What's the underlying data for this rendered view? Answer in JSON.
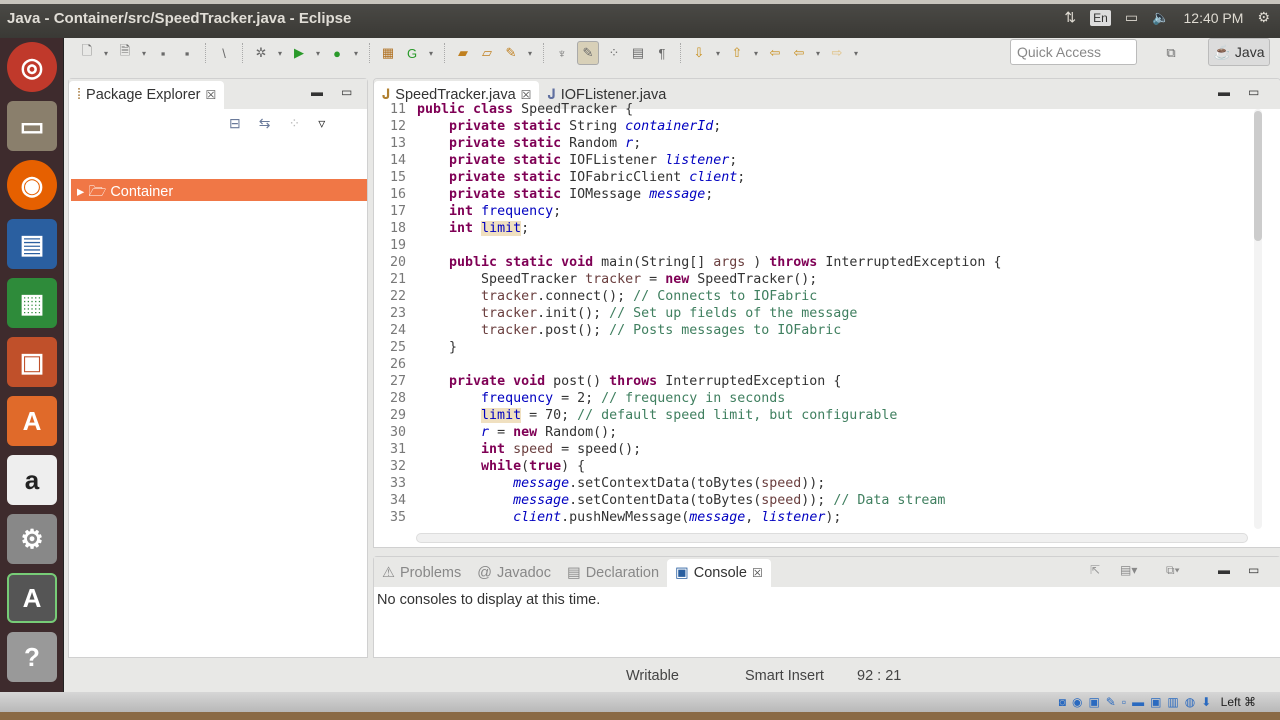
{
  "window": {
    "title": "Java - Container/src/SpeedTracker.java - Eclipse",
    "clock": "12:40 PM",
    "lang": "En"
  },
  "launcher": [
    "ubuntu-dash",
    "files",
    "firefox",
    "writer",
    "calc",
    "impress",
    "software-center",
    "amazon",
    "system-settings",
    "software-updater",
    "help"
  ],
  "toolbar": {
    "quick_access": "Quick Access",
    "perspective": "Java"
  },
  "package_explorer": {
    "title": "Package Explorer",
    "items": [
      "Container"
    ]
  },
  "editor": {
    "tabs": [
      "SpeedTracker.java",
      "IOFListener.java"
    ],
    "lines": [
      {
        "n": "11",
        "t": [
          [
            "kw",
            "public class "
          ],
          [
            "",
            "SpeedTracker {"
          ]
        ]
      },
      {
        "n": "12",
        "t": [
          [
            "",
            "    "
          ],
          [
            "kw",
            "private static "
          ],
          [
            "",
            "String "
          ],
          [
            "sfld",
            "containerId"
          ],
          [
            "",
            ";"
          ]
        ]
      },
      {
        "n": "13",
        "t": [
          [
            "",
            "    "
          ],
          [
            "kw",
            "private static "
          ],
          [
            "",
            "Random "
          ],
          [
            "sfld",
            "r"
          ],
          [
            "",
            ";"
          ]
        ]
      },
      {
        "n": "14",
        "t": [
          [
            "",
            "    "
          ],
          [
            "kw",
            "private static "
          ],
          [
            "",
            "IOFListener "
          ],
          [
            "sfld",
            "listener"
          ],
          [
            "",
            ";"
          ]
        ]
      },
      {
        "n": "15",
        "t": [
          [
            "",
            "    "
          ],
          [
            "kw",
            "private static "
          ],
          [
            "",
            "IOFabricClient "
          ],
          [
            "sfld",
            "client"
          ],
          [
            "",
            ";"
          ]
        ]
      },
      {
        "n": "16",
        "t": [
          [
            "",
            "    "
          ],
          [
            "kw",
            "private static "
          ],
          [
            "",
            "IOMessage "
          ],
          [
            "sfld",
            "message"
          ],
          [
            "",
            ";"
          ]
        ]
      },
      {
        "n": "17",
        "t": [
          [
            "",
            "    "
          ],
          [
            "kw",
            "int "
          ],
          [
            "fld",
            "frequency"
          ],
          [
            "",
            ";"
          ]
        ]
      },
      {
        "n": "18",
        "t": [
          [
            "",
            "    "
          ],
          [
            "kw",
            "int "
          ],
          [
            "fld hl",
            "limit"
          ],
          [
            "",
            ";"
          ]
        ]
      },
      {
        "n": "19",
        "t": []
      },
      {
        "n": "20",
        "t": [
          [
            "",
            "    "
          ],
          [
            "kw",
            "public static void "
          ],
          [
            "",
            "main(String[] "
          ],
          [
            "lv",
            "args"
          ],
          [
            "",
            " ) "
          ],
          [
            "kw",
            "throws "
          ],
          [
            "",
            "InterruptedException {"
          ]
        ]
      },
      {
        "n": "21",
        "t": [
          [
            "",
            "        SpeedTracker "
          ],
          [
            "lv",
            "tracker"
          ],
          [
            "",
            " = "
          ],
          [
            "kw",
            "new "
          ],
          [
            "",
            "SpeedTracker();"
          ]
        ]
      },
      {
        "n": "22",
        "t": [
          [
            "",
            "        "
          ],
          [
            "lv",
            "tracker"
          ],
          [
            "",
            ".connect(); "
          ],
          [
            "cm",
            "// Connects to IOFabric"
          ]
        ]
      },
      {
        "n": "23",
        "t": [
          [
            "",
            "        "
          ],
          [
            "lv",
            "tracker"
          ],
          [
            "",
            ".init(); "
          ],
          [
            "cm",
            "// Set up fields of the message"
          ]
        ]
      },
      {
        "n": "24",
        "t": [
          [
            "",
            "        "
          ],
          [
            "lv",
            "tracker"
          ],
          [
            "",
            ".post(); "
          ],
          [
            "cm",
            "// Posts messages to IOFabric"
          ]
        ]
      },
      {
        "n": "25",
        "t": [
          [
            "",
            "    }"
          ]
        ]
      },
      {
        "n": "26",
        "t": []
      },
      {
        "n": "27",
        "t": [
          [
            "",
            "    "
          ],
          [
            "kw",
            "private void "
          ],
          [
            "",
            "post() "
          ],
          [
            "kw",
            "throws "
          ],
          [
            "",
            "InterruptedException {"
          ]
        ]
      },
      {
        "n": "28",
        "t": [
          [
            "",
            "        "
          ],
          [
            "fld",
            "frequency"
          ],
          [
            "",
            " = 2; "
          ],
          [
            "cm",
            "// frequency in seconds"
          ]
        ]
      },
      {
        "n": "29",
        "t": [
          [
            "",
            "        "
          ],
          [
            "fld hl",
            "limit"
          ],
          [
            "",
            " = 70; "
          ],
          [
            "cm",
            "// default speed limit, but configurable"
          ]
        ]
      },
      {
        "n": "30",
        "t": [
          [
            "",
            "        "
          ],
          [
            "sfld",
            "r"
          ],
          [
            "",
            " = "
          ],
          [
            "kw",
            "new "
          ],
          [
            "",
            "Random();"
          ]
        ]
      },
      {
        "n": "31",
        "t": [
          [
            "",
            "        "
          ],
          [
            "kw",
            "int "
          ],
          [
            "lv",
            "speed"
          ],
          [
            "",
            " = speed();"
          ]
        ]
      },
      {
        "n": "32",
        "t": [
          [
            "",
            "        "
          ],
          [
            "kw",
            "while"
          ],
          [
            "",
            "("
          ],
          [
            "kw",
            "true"
          ],
          [
            "",
            ") {"
          ]
        ]
      },
      {
        "n": "33",
        "t": [
          [
            "",
            "            "
          ],
          [
            "sfld",
            "message"
          ],
          [
            "",
            ".setContextData(toBytes("
          ],
          [
            "lv",
            "speed"
          ],
          [
            "",
            "));"
          ]
        ]
      },
      {
        "n": "34",
        "t": [
          [
            "",
            "            "
          ],
          [
            "sfld",
            "message"
          ],
          [
            "",
            ".setContentData(toBytes("
          ],
          [
            "lv",
            "speed"
          ],
          [
            "",
            "));"
          ],
          [
            "cm",
            " // Data stream"
          ]
        ]
      },
      {
        "n": "35",
        "t": [
          [
            "",
            "            "
          ],
          [
            "sfld",
            "client"
          ],
          [
            "",
            ".pushNewMessage("
          ],
          [
            "sfld",
            "message"
          ],
          [
            "",
            ", "
          ],
          [
            "sfld",
            "listener"
          ],
          [
            "",
            ");"
          ]
        ]
      }
    ]
  },
  "console": {
    "tabs": [
      "Problems",
      "Javadoc",
      "Declaration",
      "Console"
    ],
    "message": "No consoles to display at this time."
  },
  "status": {
    "writable": "Writable",
    "insert_mode": "Smart Insert",
    "position": "92 : 21"
  },
  "vbox": {
    "host_key": "Left ⌘"
  }
}
